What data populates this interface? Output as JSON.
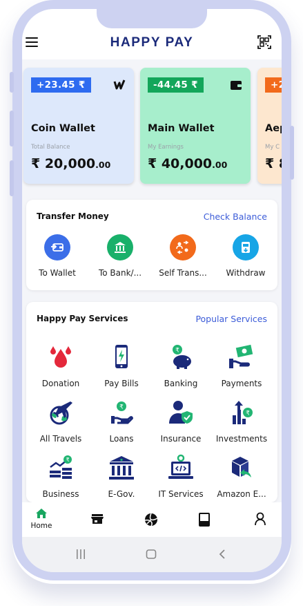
{
  "header": {
    "title": "HAPPY PAY",
    "menu_icon": "hamburger-menu-icon",
    "qr_icon": "qr-scan-icon"
  },
  "wallets": [
    {
      "change": "+23.45 ₹",
      "title": "Coin Wallet",
      "subtitle": "Total Balance",
      "amount": "₹ 20,000",
      "decimals": ".00",
      "color": "#dde8fb",
      "icon": "coin-w-logo-icon"
    },
    {
      "change": "-44.45 ₹",
      "title": "Main Wallet",
      "subtitle": "My Earnings",
      "amount": "₹ 40,000",
      "decimals": ".00",
      "color": "#a7eecc",
      "icon": "wallet-icon"
    },
    {
      "change": "+2",
      "title": "Aep",
      "subtitle": "My C",
      "amount": "₹ 8",
      "decimals": "",
      "color": "#fde7cf"
    }
  ],
  "transfer": {
    "title": "Transfer Money",
    "link": "Check Balance",
    "items": [
      {
        "label": "To Wallet",
        "color": "#3b6ee8",
        "icon": "wallet-transfer-icon"
      },
      {
        "label": "To Bank/...",
        "color": "#19b06a",
        "icon": "bank-icon"
      },
      {
        "label": "Self Trans...",
        "color": "#f26a1b",
        "icon": "self-transfer-icon"
      },
      {
        "label": "Withdraw",
        "color": "#17a5e6",
        "icon": "withdraw-icon"
      }
    ]
  },
  "services": {
    "title": "Happy Pay Services",
    "link": "Popular Services",
    "items": [
      {
        "label": "Donation",
        "icon": "blood-drop-icon"
      },
      {
        "label": "Pay Bills",
        "icon": "mobile-bill-icon"
      },
      {
        "label": "Banking",
        "icon": "piggy-bank-icon"
      },
      {
        "label": "Payments",
        "icon": "cash-payment-icon"
      },
      {
        "label": "All Travels",
        "icon": "globe-plane-icon"
      },
      {
        "label": "Loans",
        "icon": "loan-hand-icon"
      },
      {
        "label": "Insurance",
        "icon": "insurance-person-icon"
      },
      {
        "label": "Investments",
        "icon": "investment-chart-icon"
      },
      {
        "label": "Business",
        "icon": "business-coins-icon"
      },
      {
        "label": "E-Gov.",
        "icon": "government-building-icon"
      },
      {
        "label": "IT Services",
        "icon": "laptop-code-icon"
      },
      {
        "label": "Amazon E...",
        "icon": "package-return-icon"
      }
    ]
  },
  "bottom_nav": [
    {
      "label": "Home",
      "icon": "home-icon"
    },
    {
      "label": "",
      "icon": "store-icon"
    },
    {
      "label": "",
      "icon": "sports-ball-icon"
    },
    {
      "label": "",
      "icon": "card-icon"
    },
    {
      "label": "",
      "icon": "profile-icon"
    }
  ],
  "colors": {
    "brand": "#1b2a7a",
    "accent_link": "#3c5cd8",
    "frame": "#cdd2f1"
  }
}
